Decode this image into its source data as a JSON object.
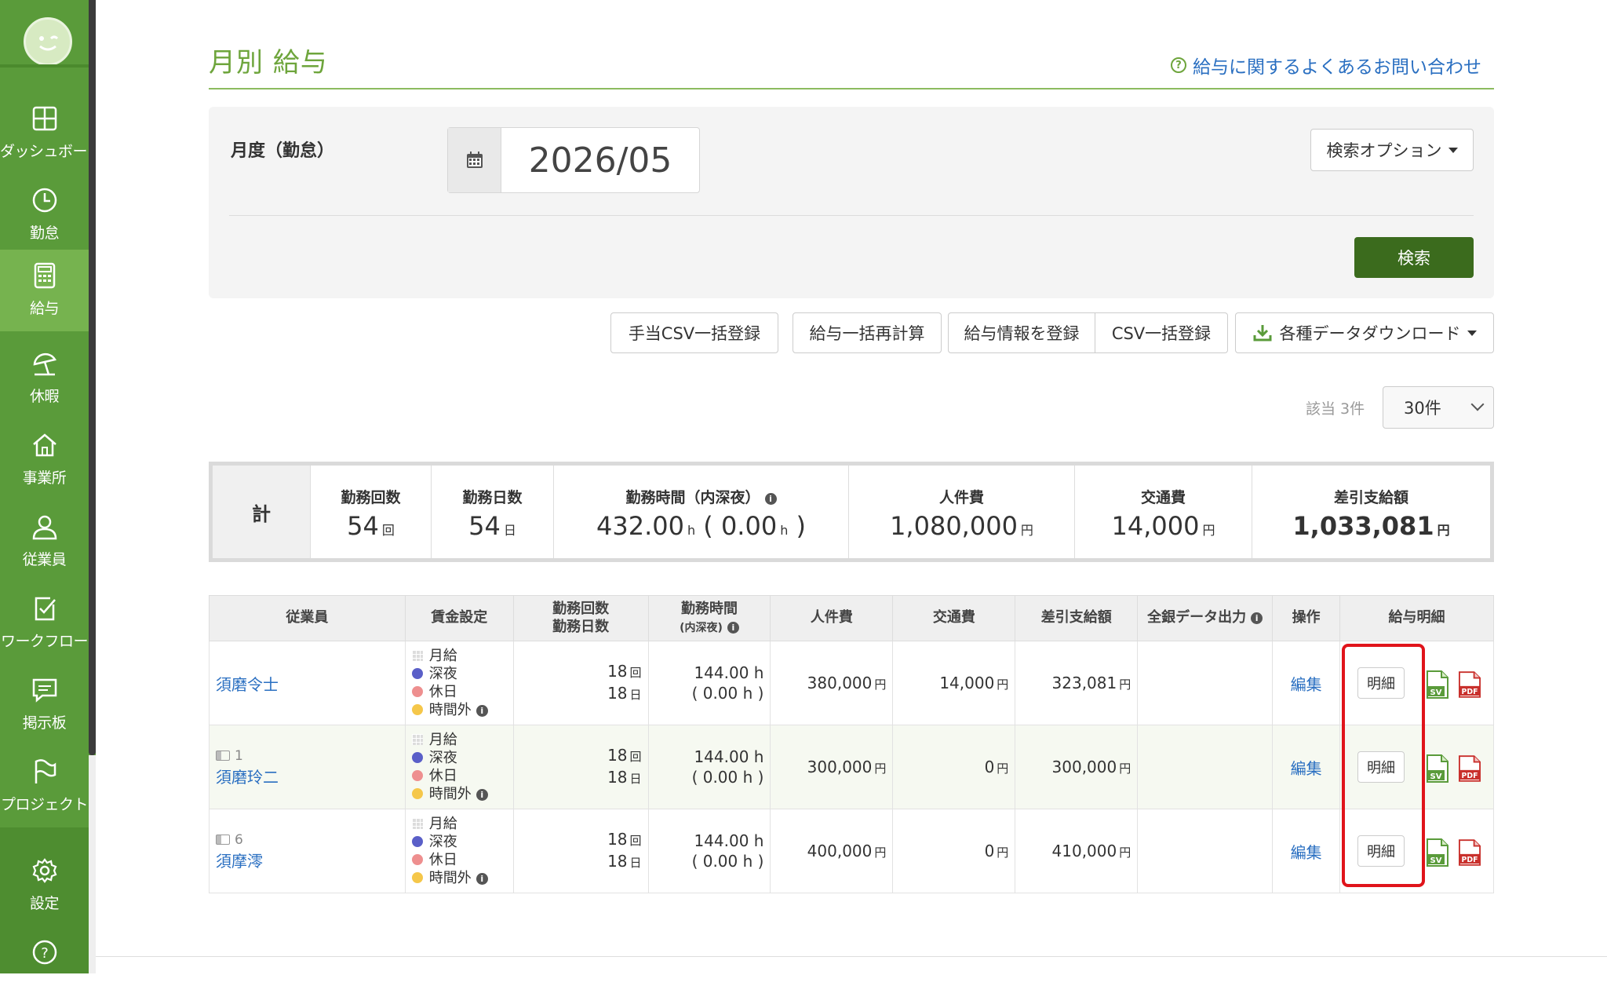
{
  "sidebar": {
    "items": [
      {
        "label": "ダッシュボード",
        "icon": "dashboard-icon"
      },
      {
        "label": "勤怠",
        "icon": "clock-icon"
      },
      {
        "label": "給与",
        "icon": "calculator-icon"
      },
      {
        "label": "休暇",
        "icon": "umbrella-icon"
      },
      {
        "label": "事業所",
        "icon": "home-icon"
      },
      {
        "label": "従業員",
        "icon": "user-icon"
      },
      {
        "label": "ワークフロー",
        "icon": "workflow-icon"
      },
      {
        "label": "掲示板",
        "icon": "chat-icon"
      },
      {
        "label": "プロジェクト",
        "icon": "flag-icon"
      },
      {
        "label": "設定",
        "icon": "gear-icon"
      },
      {
        "label": "ヘルプ",
        "icon": "help-icon"
      }
    ],
    "active_index": 2
  },
  "header": {
    "title": "月別 給与",
    "faq_link": "給与に関するよくあるお問い合わせ"
  },
  "search": {
    "period_label": "月度（勤怠）",
    "period_value": "2026/05",
    "options_button": "検索オプション",
    "search_button": "検索"
  },
  "actions": {
    "allowance_csv": "手当CSV一括登録",
    "recalc": "給与一括再計算",
    "register_info": "給与情報を登録",
    "csv_bulk": "CSV一括登録",
    "download": "各種データダウンロード"
  },
  "paging": {
    "count_text": "該当 3件",
    "per_page": "30件"
  },
  "totals": {
    "label": "計",
    "columns": [
      {
        "header": "勤務回数",
        "value": "54",
        "unit": "回"
      },
      {
        "header": "勤務日数",
        "value": "54",
        "unit": "日"
      },
      {
        "header": "勤務時間（内深夜）",
        "value": "432.00",
        "unit": "h",
        "sub_value": "0.00",
        "sub_unit": "h"
      },
      {
        "header": "人件費",
        "value": "1,080,000",
        "unit": "円"
      },
      {
        "header": "交通費",
        "value": "14,000",
        "unit": "円"
      },
      {
        "header": "差引支給額",
        "value": "1,033,081",
        "unit": "円"
      }
    ]
  },
  "table": {
    "headers": {
      "employee": "従業員",
      "wage": "賃金設定",
      "count_days_1": "勤務回数",
      "count_days_2": "勤務日数",
      "hours_1": "勤務時間",
      "hours_2": "(内深夜)",
      "labor": "人件費",
      "transport": "交通費",
      "net": "差引支給額",
      "bank": "全銀データ出力",
      "ops": "操作",
      "payslip": "給与明細"
    },
    "wage_types": [
      "月給",
      "深夜",
      "休日",
      "時間外"
    ],
    "wage_colors": [
      "#cccccc",
      "#5a5fc8",
      "#ee8f8f",
      "#f5c74a"
    ],
    "rows": [
      {
        "id": "",
        "name": "須磨令士",
        "count": "18",
        "count_unit": "回",
        "days": "18",
        "days_unit": "日",
        "hours": "144.00 h",
        "night": "( 0.00 h )",
        "labor": "380,000",
        "transport": "14,000",
        "net": "323,081",
        "edit": "編集",
        "detail": "明細"
      },
      {
        "id": "1",
        "name": "須磨玲二",
        "count": "18",
        "count_unit": "回",
        "days": "18",
        "days_unit": "日",
        "hours": "144.00 h",
        "night": "( 0.00 h )",
        "labor": "300,000",
        "transport": "0",
        "net": "300,000",
        "edit": "編集",
        "detail": "明細"
      },
      {
        "id": "6",
        "name": "須摩澪",
        "count": "18",
        "count_unit": "回",
        "days": "18",
        "days_unit": "日",
        "hours": "144.00 h",
        "night": "( 0.00 h )",
        "labor": "400,000",
        "transport": "0",
        "net": "410,000",
        "edit": "編集",
        "detail": "明細"
      }
    ],
    "yen": "円",
    "csv_label": "SV",
    "pdf_label": "PDF"
  },
  "colors": {
    "sidebar": "#5a9b3a",
    "accent": "#6ea53c",
    "primary_button": "#3b6b1d",
    "link": "#2a6fc1",
    "highlight": "#e0141b"
  }
}
